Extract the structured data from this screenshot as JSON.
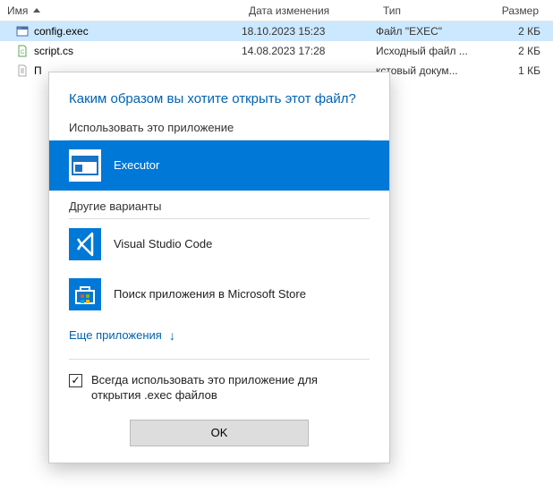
{
  "columns": {
    "name": "Имя",
    "date": "Дата изменения",
    "type": "Тип",
    "size": "Размер"
  },
  "files": [
    {
      "name": "config.exec",
      "date": "18.10.2023 15:23",
      "type": "Файл \"EXEC\"",
      "size": "2 КБ",
      "selected": true,
      "icon": "exec"
    },
    {
      "name": "script.cs",
      "date": "14.08.2023 17:28",
      "type": "Исходный файл ...",
      "size": "2 КБ",
      "selected": false,
      "icon": "cs"
    },
    {
      "name": "П",
      "date": "",
      "type": " кстовый докум...",
      "size": "1 КБ",
      "selected": false,
      "icon": "txt"
    }
  ],
  "dialog": {
    "title": "Каким образом вы хотите открыть этот файл?",
    "useThisApp": "Использовать это приложение",
    "otherOptions": "Другие варианты",
    "apps": {
      "executor": "Executor",
      "vscode": "Visual Studio Code",
      "store": "Поиск приложения в Microsoft Store"
    },
    "moreApps": "Еще приложения",
    "alwaysUse": "Всегда использовать это приложение для открытия .exec файлов",
    "checked": true,
    "ok": "OK"
  }
}
